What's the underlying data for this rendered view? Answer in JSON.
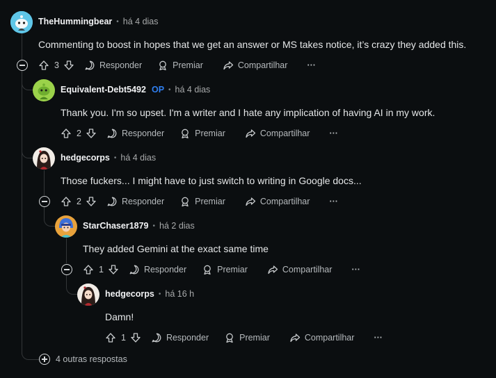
{
  "comments": [
    {
      "author": "TheHummingbear",
      "op": "",
      "time": "há 4 dias",
      "text": "Commenting to boost in hopes that we get an answer or MS takes notice, it’s crazy they added this.",
      "score": "3"
    },
    {
      "author": "Equivalent-Debt5492",
      "op": "OP",
      "time": "há 4 dias",
      "text": "Thank you. I'm so upset. I'm a writer and I hate any implication of having AI in my work.",
      "score": "2"
    },
    {
      "author": "hedgecorps",
      "op": "",
      "time": "há 4 dias",
      "text": "Those fuckers... I might have to just switch to writing in Google docs...",
      "score": "2"
    },
    {
      "author": "StarChaser1879",
      "op": "",
      "time": "há 2 dias",
      "text": "They added Gemini at the exact same time",
      "score": "1"
    },
    {
      "author": "hedgecorps",
      "op": "",
      "time": "há 16 h",
      "text": "Damn!",
      "score": "1"
    }
  ],
  "actions": {
    "reply": "Responder",
    "award": "Premiar",
    "share": "Compartilhar",
    "more": "···"
  },
  "separator": "•",
  "more_replies": "4 outras respostas",
  "colors": {
    "background": "#0b0e10",
    "op_badge": "#2f7ff0",
    "thread_line": "#343739"
  }
}
